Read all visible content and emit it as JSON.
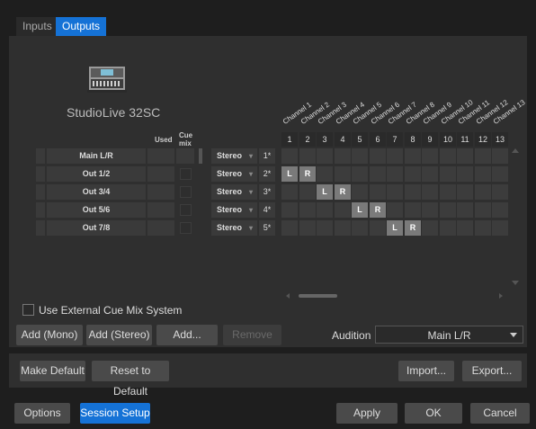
{
  "tabs": [
    {
      "label": "Inputs",
      "active": false
    },
    {
      "label": "Outputs",
      "active": true
    }
  ],
  "device": {
    "name": "StudioLive 32SC"
  },
  "headers": {
    "used": "Used",
    "cue_mix": "Cue\nmix"
  },
  "channels": [
    "Channel 1",
    "Channel 2",
    "Channel 3",
    "Channel 4",
    "Channel 5",
    "Channel 6",
    "Channel 7",
    "Channel 8",
    "Channel 9",
    "Channel 10",
    "Channel 11",
    "Channel 12",
    "Channel 13"
  ],
  "channel_numbers": [
    "1",
    "2",
    "3",
    "4",
    "5",
    "6",
    "7",
    "8",
    "9",
    "10",
    "11",
    "12",
    "13"
  ],
  "rows": [
    {
      "name": "Main L/R",
      "mode": "Stereo",
      "num": "1*",
      "assign": []
    },
    {
      "name": "Out 1/2",
      "mode": "Stereo",
      "num": "2*",
      "assign": [
        {
          "col": 0,
          "label": "L"
        },
        {
          "col": 1,
          "label": "R"
        }
      ]
    },
    {
      "name": "Out 3/4",
      "mode": "Stereo",
      "num": "3*",
      "assign": [
        {
          "col": 2,
          "label": "L"
        },
        {
          "col": 3,
          "label": "R"
        }
      ]
    },
    {
      "name": "Out 5/6",
      "mode": "Stereo",
      "num": "4*",
      "assign": [
        {
          "col": 4,
          "label": "L"
        },
        {
          "col": 5,
          "label": "R"
        }
      ]
    },
    {
      "name": "Out 7/8",
      "mode": "Stereo",
      "num": "5*",
      "assign": [
        {
          "col": 6,
          "label": "L"
        },
        {
          "col": 7,
          "label": "R"
        }
      ]
    }
  ],
  "external_cue": {
    "label": "Use External Cue Mix System",
    "checked": false
  },
  "buttons": {
    "add_mono": "Add (Mono)",
    "add_stereo": "Add (Stereo)",
    "add": "Add...",
    "remove": "Remove",
    "make_default": "Make Default",
    "reset_default": "Reset to Default",
    "import": "Import...",
    "export": "Export...",
    "options": "Options",
    "session_setup": "Session Setup",
    "apply": "Apply",
    "ok": "OK",
    "cancel": "Cancel"
  },
  "audition": {
    "label": "Audition",
    "value": "Main L/R"
  },
  "colors": {
    "accent": "#1572d6"
  }
}
